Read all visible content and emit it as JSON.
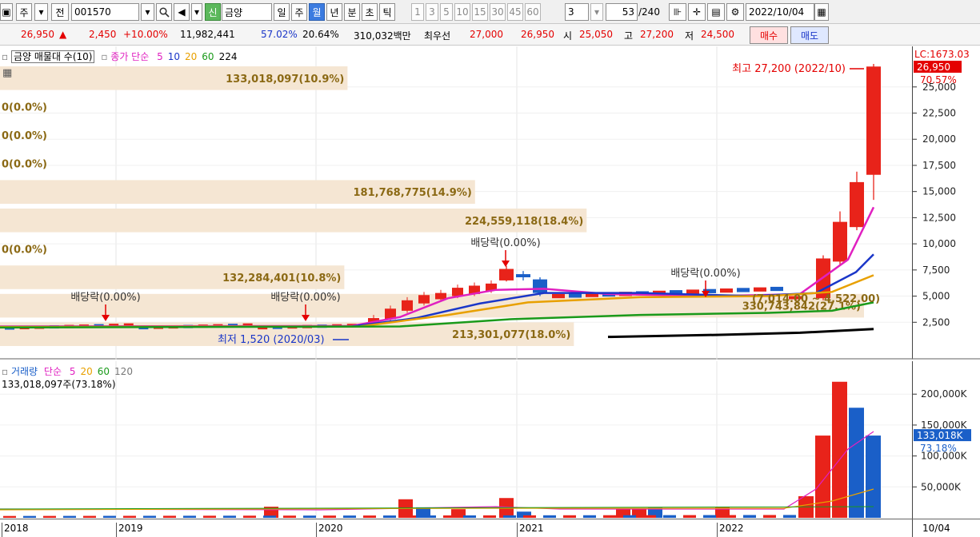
{
  "toolbar": {
    "period_w": "주",
    "prev_label": "전",
    "stock_code": "001570",
    "stock_badge": "신",
    "stock_name": "금양",
    "period_tabs": [
      {
        "label": "일",
        "active": false
      },
      {
        "label": "주",
        "active": false
      },
      {
        "label": "월",
        "active": true
      },
      {
        "label": "년",
        "active": false
      },
      {
        "label": "분",
        "active": false
      },
      {
        "label": "초",
        "active": false
      },
      {
        "label": "틱",
        "active": false
      }
    ],
    "intervals": [
      "1",
      "3",
      "5",
      "10",
      "15",
      "30",
      "45",
      "60"
    ],
    "interval_value": "3",
    "count": "53",
    "count_total": "/240",
    "date": "2022/10/04"
  },
  "quote": {
    "price": "26,950",
    "change": "2,450",
    "change_pct": "+10.00%",
    "volume": "11,982,441",
    "ratio1": "57.02%",
    "ratio2": "20.64%",
    "amount": "310,032백만",
    "best_label": "최우선",
    "ask": "27,000",
    "bid": "26,950",
    "open_label": "시",
    "open": "25,050",
    "high_label": "고",
    "high": "27,200",
    "low_label": "저",
    "low": "24,500",
    "buy_label": "매수",
    "sell_label": "매도"
  },
  "price_legend": {
    "profile_label": "금양 매물대 수(10)",
    "ma_label": "종가 단순",
    "ma_periods": [
      "5",
      "10",
      "20",
      "60",
      "224"
    ],
    "ma_colors": [
      "#e020c0",
      "#1a36c8",
      "#e8a000",
      "#1a9a1a",
      "#000000"
    ]
  },
  "volume_profile": [
    {
      "label": "133,018,097(10.9%)",
      "value_pct": 10.9
    },
    {
      "label": "0(0.0%)",
      "value_pct": 0
    },
    {
      "label": "0(0.0%)",
      "value_pct": 0
    },
    {
      "label": "0(0.0%)",
      "value_pct": 0
    },
    {
      "label": "181,768,775(14.9%)",
      "value_pct": 14.9
    },
    {
      "label": "224,559,118(18.4%)",
      "value_pct": 18.4
    },
    {
      "label": "0(0.0%)",
      "value_pct": 0
    },
    {
      "label": "132,284,401(10.8%)",
      "value_pct": 10.8
    },
    {
      "label": "330,743,842(27.1%)",
      "value_pct": 27.1
    },
    {
      "label": "213,301,077(18.0%)",
      "value_pct": 18.0
    }
  ],
  "price_annotations": {
    "high_label": "최고 27,200 (2022/10)",
    "low_label": "최저 1,520 (2020/03)",
    "range_label": "(7,014.00 ~ 4,522.00)",
    "dividend_label": "배당락(0.00%)"
  },
  "price_axis": {
    "lc_label": "LC:1673.03",
    "current": "26,950",
    "current_pct": "70.57%",
    "ticks": [
      "25,000",
      "22,500",
      "20,000",
      "17,500",
      "15,000",
      "12,500",
      "10,000",
      "7,500",
      "5,000",
      "2,500"
    ]
  },
  "volume_legend": {
    "label": "거래량",
    "ma_label": "단순",
    "ma_periods": [
      "5",
      "20",
      "60",
      "120"
    ],
    "current": "133,018,097주(73.18%)"
  },
  "volume_axis": {
    "ticks": [
      "200,000K",
      "150,000K",
      "100,000K",
      "50,000K"
    ],
    "current": "133,018K",
    "current_pct": "73.18%"
  },
  "date_axis": {
    "years": [
      "2018",
      "2019",
      "2020",
      "2021",
      "2022"
    ],
    "last": "10/04"
  },
  "colors": {
    "up": "#e8231a",
    "down": "#1a5fc8",
    "profile": "#f5e6d3",
    "profile_text": "#8b6914"
  },
  "chart_data": {
    "type": "candlestick",
    "period": "monthly",
    "y_range": [
      0,
      27200
    ],
    "volume_range": [
      0,
      230000
    ],
    "candles": [
      {
        "date": "2021-01",
        "open": 6500,
        "close": 7600,
        "high": 7900,
        "low": 6400
      },
      {
        "date": "2021-02",
        "open": 7100,
        "close": 6800,
        "high": 7400,
        "low": 6500
      },
      {
        "date": "2021-03",
        "open": 6600,
        "close": 5300,
        "high": 6800,
        "low": 5000
      },
      {
        "date": "2022-05",
        "open": 4700,
        "close": 5000,
        "high": 5200,
        "low": 4500
      },
      {
        "date": "2022-06",
        "open": 4800,
        "close": 8600,
        "high": 8900,
        "low": 4600
      },
      {
        "date": "2022-07",
        "open": 8300,
        "close": 12100,
        "high": 13100,
        "low": 8000
      },
      {
        "date": "2022-08",
        "open": 11600,
        "close": 15900,
        "high": 16900,
        "low": 11300
      },
      {
        "date": "2022-09",
        "open": 16600,
        "close": 26950,
        "high": 27200,
        "low": 14200
      },
      {
        "date": "2022-10",
        "open": 25050,
        "close": 26950,
        "high": 27200,
        "low": 24500
      }
    ],
    "volume_recent": [
      {
        "date": "2022-05",
        "value": 35000
      },
      {
        "date": "2022-06",
        "value": 133000
      },
      {
        "date": "2022-07",
        "value": 220000
      },
      {
        "date": "2022-08",
        "value": 178000
      },
      {
        "date": "2022-09",
        "value": 133018
      }
    ]
  }
}
